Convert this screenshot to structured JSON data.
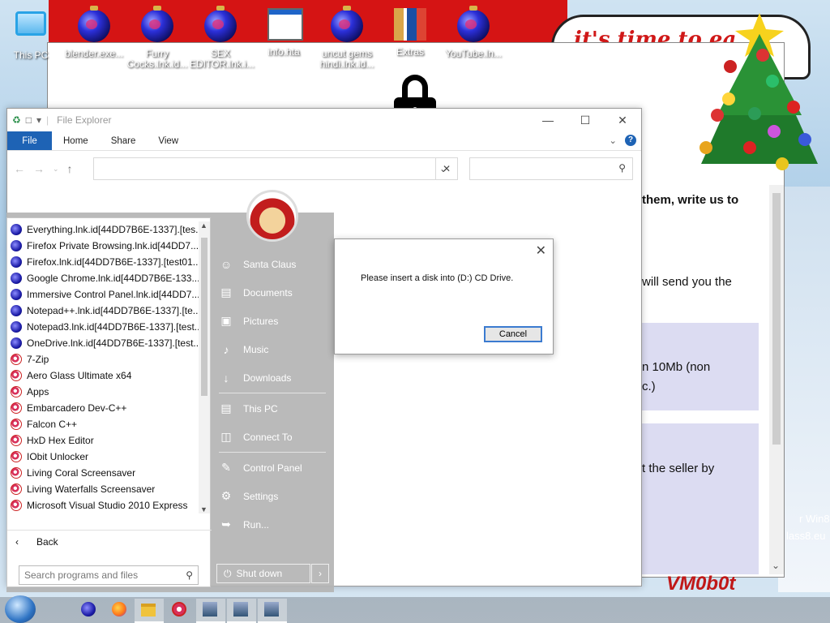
{
  "desktop": {
    "icons": [
      {
        "label": "This PC",
        "icon": "this-pc-icon"
      },
      {
        "label": "blender.exe...",
        "icon": "ornament-icon"
      },
      {
        "label": "Furry Cocks.lnk.id...",
        "icon": "ornament-icon"
      },
      {
        "label": "SEX EDITOR.lnk.i...",
        "icon": "ornament-icon"
      },
      {
        "label": "info.hta",
        "icon": "hta-icon"
      },
      {
        "label": "uncut gems hindi.lnk.id...",
        "icon": "ornament-icon"
      },
      {
        "label": "Extras",
        "icon": "extras-icon"
      },
      {
        "label": "YouTube.ln...",
        "icon": "ornament-icon"
      }
    ]
  },
  "wallpaper": {
    "bubble_text": "it's time to ea",
    "bubble_text_tail": "t",
    "bottom_text": "VM0b0t"
  },
  "background_window": {
    "text_lines": [
      "them, write us to",
      "will send you the",
      "n 10Mb (non",
      "c.)",
      "t the seller by",
      "r Win8.1",
      "lass8.eu"
    ]
  },
  "file_explorer": {
    "title": "File Explorer",
    "tabs": {
      "file": "File",
      "home": "Home",
      "share": "Share",
      "view": "View"
    },
    "address_value": "",
    "search_placeholder": ""
  },
  "start_menu": {
    "programs": [
      {
        "label": "Everything.lnk.id[44DD7B6E-1337].[tes...",
        "icon": "blue"
      },
      {
        "label": "Firefox Private Browsing.lnk.id[44DD7...",
        "icon": "blue"
      },
      {
        "label": "Firefox.lnk.id[44DD7B6E-1337].[test01...",
        "icon": "blue"
      },
      {
        "label": "Google Chrome.lnk.id[44DD7B6E-133...",
        "icon": "blue"
      },
      {
        "label": "Immersive Control Panel.lnk.id[44DD7...",
        "icon": "blue"
      },
      {
        "label": "Notepad++.lnk.id[44DD7B6E-1337].[te...",
        "icon": "blue"
      },
      {
        "label": "Notepad3.lnk.id[44DD7B6E-1337].[test...",
        "icon": "blue"
      },
      {
        "label": "OneDrive.lnk.id[44DD7B6E-1337].[test...",
        "icon": "blue"
      },
      {
        "label": "7-Zip",
        "icon": "red"
      },
      {
        "label": "Aero Glass Ultimate x64",
        "icon": "red"
      },
      {
        "label": "Apps",
        "icon": "red"
      },
      {
        "label": "Embarcadero Dev-C++",
        "icon": "red"
      },
      {
        "label": "Falcon C++",
        "icon": "red"
      },
      {
        "label": "HxD Hex Editor",
        "icon": "red"
      },
      {
        "label": "IObit Unlocker",
        "icon": "red"
      },
      {
        "label": "Living Coral Screensaver",
        "icon": "red"
      },
      {
        "label": "Living Waterfalls Screensaver",
        "icon": "red"
      },
      {
        "label": "Microsoft Visual Studio 2010 Express",
        "icon": "red"
      }
    ],
    "back_label": "Back",
    "search_placeholder": "Search programs and files",
    "right_items": [
      {
        "label": "Santa Claus",
        "icon": "user-icon"
      },
      {
        "label": "Documents",
        "icon": "documents-icon"
      },
      {
        "label": "Pictures",
        "icon": "pictures-icon"
      },
      {
        "label": "Music",
        "icon": "music-icon"
      },
      {
        "label": "Downloads",
        "icon": "downloads-icon"
      },
      {
        "label": "This PC",
        "icon": "computer-icon"
      },
      {
        "label": "Connect To",
        "icon": "connect-icon"
      },
      {
        "label": "Control Panel",
        "icon": "control-panel-icon"
      },
      {
        "label": "Settings",
        "icon": "settings-icon"
      },
      {
        "label": "Run...",
        "icon": "run-icon"
      }
    ],
    "shutdown_label": "Shut down",
    "shutdown_arrow": "›"
  },
  "dialog": {
    "message": "Please insert a disk into (D:) CD Drive.",
    "cancel_label": "Cancel"
  },
  "taskbar": {
    "items": [
      "ornament-icon",
      "firefox-icon",
      "file-explorer-icon",
      "star-ornament-icon",
      "network-icon",
      "network-icon",
      "network-icon"
    ]
  }
}
